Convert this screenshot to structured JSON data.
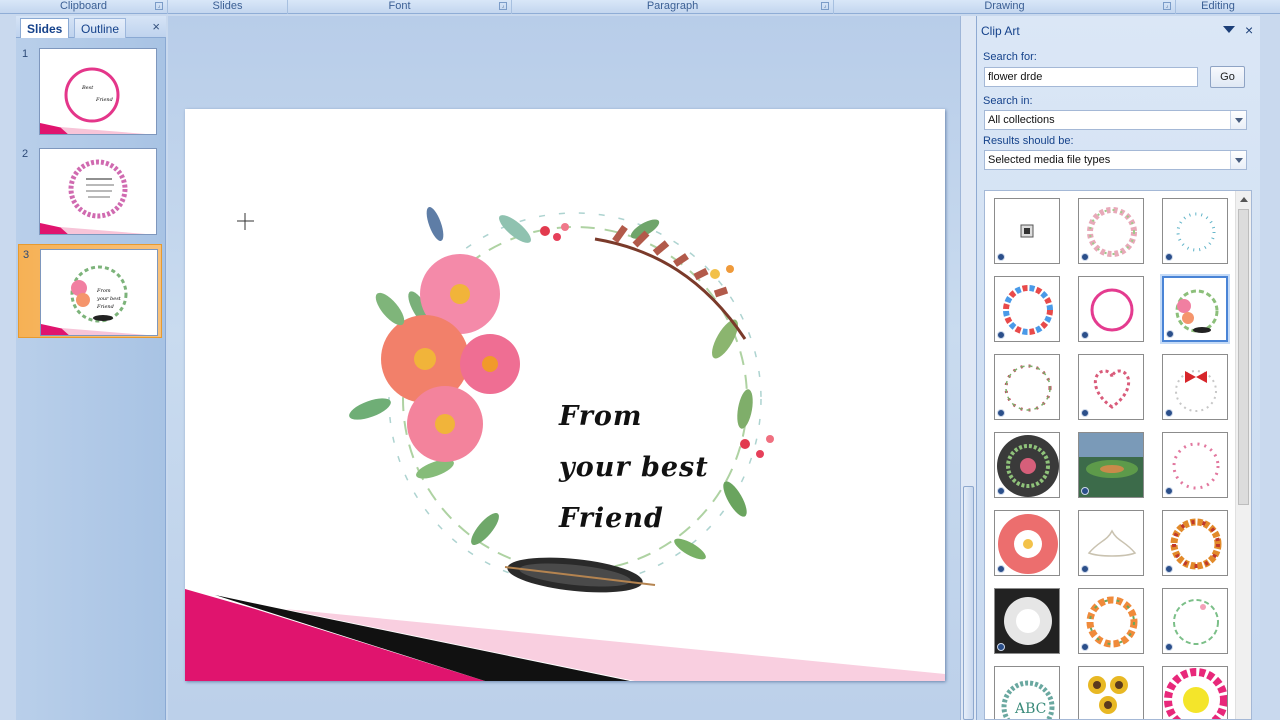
{
  "ribbon": {
    "groups": [
      "Clipboard",
      "Slides",
      "Font",
      "Paragraph",
      "Drawing",
      "Editing"
    ]
  },
  "slides_pane": {
    "tabs": [
      "Slides",
      "Outline"
    ],
    "close": "×",
    "slides": [
      {
        "number": "1"
      },
      {
        "number": "2"
      },
      {
        "number": "3",
        "selected": true
      }
    ]
  },
  "slide": {
    "lines": [
      "From",
      "your best",
      "Friend"
    ]
  },
  "clipart": {
    "title": "Clip Art",
    "close": "×",
    "search_label": "Search for:",
    "search_value": "flower drde",
    "go_label": "Go",
    "search_in_label": "Search in:",
    "search_in_value": "All collections",
    "results_label": "Results should be:",
    "results_value": "Selected media file types",
    "selected_index": 5,
    "results": [
      "placeholder-icon",
      "floral-ring",
      "dotted-ring",
      "rainbow-dot-ring",
      "pink-ring",
      "watercolor-wreath",
      "rose-ring",
      "heart-wreath",
      "red-bow-ring",
      "mandala-dark",
      "garden-photo",
      "pink-dot-ring",
      "daisy-circle",
      "lotus",
      "autumn-wreath",
      "white-peony",
      "orange-flower-ring",
      "green-leaf-ring",
      "monogram-abc",
      "sunflower-pattern",
      "pink-yellow-flower"
    ]
  },
  "colors": {
    "accent_pink": "#e0146e",
    "selection_orange": "#f6b155",
    "ribbon_text": "#15428b"
  }
}
